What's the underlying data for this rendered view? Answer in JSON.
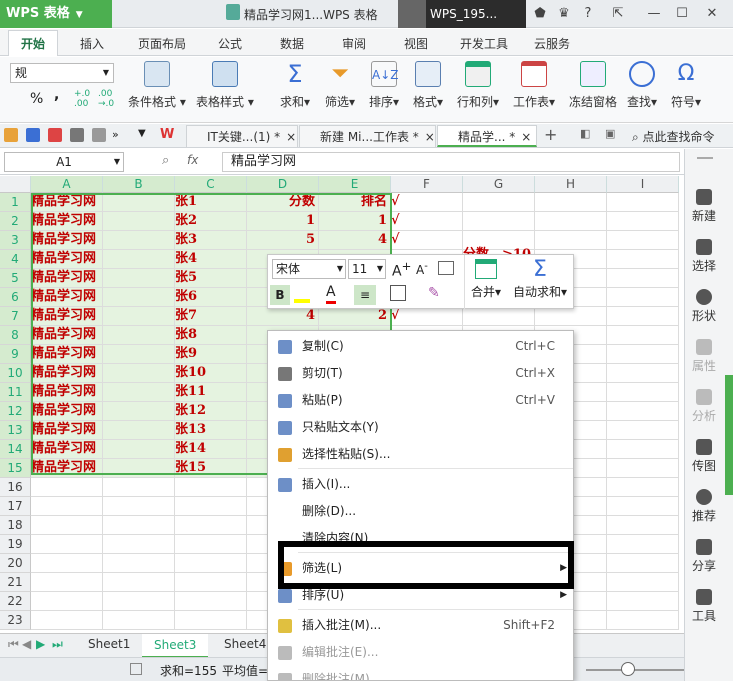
{
  "app": {
    "name": "WPS 表格",
    "doc_title": "精品学习网1...WPS 表格",
    "user": "WPS_195..."
  },
  "menu_tabs": [
    "开始",
    "插入",
    "页面布局",
    "公式",
    "数据",
    "审阅",
    "视图",
    "开发工具",
    "云服务"
  ],
  "ribbon": {
    "number_format": "规",
    "percent": "%",
    "comma": ",",
    "buttons": [
      "条件格式",
      "表格样式",
      "求和",
      "筛选",
      "排序",
      "格式",
      "行和列",
      "工作表",
      "冻结窗格",
      "查找",
      "符号"
    ]
  },
  "doc_tabs": [
    {
      "label": "IT关键...(1) *",
      "close": "×"
    },
    {
      "label": "新建 Mi...工作表 *",
      "close": "×"
    },
    {
      "label": "精品学... *",
      "close": "×"
    }
  ],
  "search_placeholder": "点此查找命令",
  "formula": {
    "name_box": "A1",
    "fx": "fx",
    "content": "精品学习网"
  },
  "columns": [
    "A",
    "B",
    "C",
    "D",
    "E",
    "F",
    "G",
    "H",
    "I"
  ],
  "rows": [
    {
      "n": "1",
      "a": "精品学习网",
      "c": "张1",
      "d": "分数",
      "e": "排名",
      "f": "√"
    },
    {
      "n": "2",
      "a": "精品学习网",
      "c": "张2",
      "d": "1",
      "e": "1",
      "f": "√"
    },
    {
      "n": "3",
      "a": "精品学习网",
      "c": "张3",
      "d": "5",
      "e": "4",
      "f": "√"
    },
    {
      "n": "4",
      "a": "精品学习网",
      "c": "张4",
      "d": "",
      "e": "",
      "f": ""
    },
    {
      "n": "5",
      "a": "精品学习网",
      "c": "张5",
      "d": "",
      "e": "",
      "f": ""
    },
    {
      "n": "6",
      "a": "精品学习网",
      "c": "张6",
      "d": "",
      "e": "",
      "f": ""
    },
    {
      "n": "7",
      "a": "精品学习网",
      "c": "张7",
      "d": "4",
      "e": "2",
      "f": "√"
    },
    {
      "n": "8",
      "a": "精品学习网",
      "c": "张8",
      "d": "",
      "e": "",
      "f": ""
    },
    {
      "n": "9",
      "a": "精品学习网",
      "c": "张9",
      "d": "",
      "e": "",
      "f": ""
    },
    {
      "n": "10",
      "a": "精品学习网",
      "c": "张10",
      "d": "",
      "e": "",
      "f": ""
    },
    {
      "n": "11",
      "a": "精品学习网",
      "c": "张11",
      "d": "",
      "e": "",
      "f": ""
    },
    {
      "n": "12",
      "a": "精品学习网",
      "c": "张12",
      "d": "",
      "e": "",
      "f": ""
    },
    {
      "n": "13",
      "a": "精品学习网",
      "c": "张13",
      "d": "",
      "e": "",
      "f": ""
    },
    {
      "n": "14",
      "a": "精品学习网",
      "c": "张14",
      "d": "",
      "e": "",
      "f": ""
    },
    {
      "n": "15",
      "a": "精品学习网",
      "c": "张15",
      "d": "",
      "e": "",
      "f": ""
    },
    {
      "n": "16"
    },
    {
      "n": "17"
    },
    {
      "n": "18"
    },
    {
      "n": "19"
    },
    {
      "n": "20"
    },
    {
      "n": "21"
    },
    {
      "n": "22"
    },
    {
      "n": "23"
    }
  ],
  "side_label_partial": "分数　>10",
  "mini_toolbar": {
    "font": "宋体",
    "size": "11",
    "merge": "合并",
    "autosum": "自动求和"
  },
  "context_menu": [
    {
      "label": "复制(C)",
      "shortcut": "Ctrl+C"
    },
    {
      "label": "剪切(T)",
      "shortcut": "Ctrl+X"
    },
    {
      "label": "粘贴(P)",
      "shortcut": "Ctrl+V"
    },
    {
      "label": "只粘贴文本(Y)",
      "shortcut": ""
    },
    {
      "label": "选择性粘贴(S)...",
      "shortcut": ""
    },
    {
      "label": "插入(I)...",
      "shortcut": ""
    },
    {
      "label": "删除(D)...",
      "shortcut": ""
    },
    {
      "label": "清除内容(N)",
      "shortcut": ""
    },
    {
      "label": "筛选(L)",
      "shortcut": ""
    },
    {
      "label": "排序(U)",
      "shortcut": ""
    },
    {
      "label": "插入批注(M)...",
      "shortcut": "Shift+F2"
    },
    {
      "label": "编辑批注(E)...",
      "shortcut": ""
    },
    {
      "label": "删除批注(M)",
      "shortcut": ""
    }
  ],
  "side_panel": [
    "新建",
    "选择",
    "形状",
    "属性",
    "分析",
    "传图",
    "推荐",
    "分享",
    "工具"
  ],
  "sheets": [
    "Sheet1",
    "Sheet3",
    "Sheet4"
  ],
  "status": {
    "sum": "求和=155",
    "avg": "平均值="
  },
  "colors": {
    "accent": "#4caf50",
    "selection": "#e5f3e0",
    "red_text": "#c00000"
  }
}
